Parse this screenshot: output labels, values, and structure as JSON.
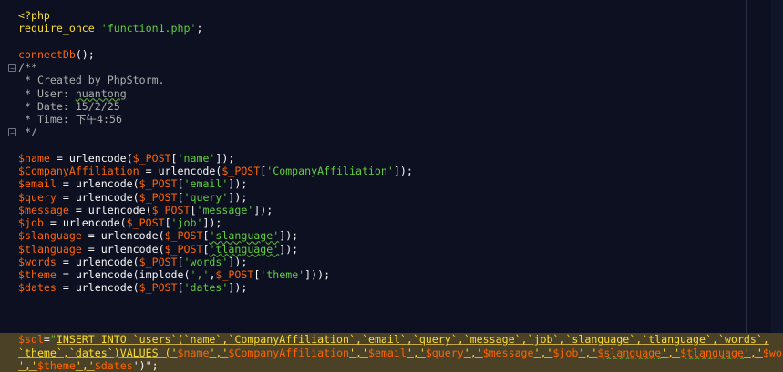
{
  "colors": {
    "background": "#0c1021",
    "keyword": "#fbde2d",
    "string": "#61ce3c",
    "variable": "#ff6400",
    "comment": "#aeaeae",
    "text": "#f8f8f8",
    "highlight_row": "#4b4126"
  },
  "icons": {
    "fold_open": "fold-open-icon",
    "fold_close": "fold-close-icon"
  },
  "lines": [
    {
      "tokens": [
        {
          "t": "<?php",
          "c": "k-kw"
        }
      ]
    },
    {
      "tokens": [
        {
          "t": "require_once ",
          "c": "k-kw"
        },
        {
          "t": "'function1.php'",
          "c": "k-str"
        },
        {
          "t": ";",
          "c": "k-plain"
        }
      ]
    },
    {
      "tokens": []
    },
    {
      "tokens": [
        {
          "t": "connectDb",
          "c": "k-var"
        },
        {
          "t": "();",
          "c": "k-plain"
        }
      ]
    },
    {
      "fold": "open",
      "tokens": [
        {
          "t": "/**",
          "c": "k-cmt"
        }
      ]
    },
    {
      "tokens": [
        {
          "t": " * Created by PhpStorm.",
          "c": "k-cmt"
        }
      ]
    },
    {
      "tokens": [
        {
          "t": " * User: ",
          "c": "k-cmt"
        },
        {
          "t": "huantong",
          "c": "k-cmt",
          "wavy": true
        }
      ]
    },
    {
      "tokens": [
        {
          "t": " * Date: 15/2/25",
          "c": "k-cmt"
        }
      ]
    },
    {
      "tokens": [
        {
          "t": " * Time: 下午4:56",
          "c": "k-cmt"
        }
      ]
    },
    {
      "fold": "close",
      "tokens": [
        {
          "t": " */",
          "c": "k-cmt"
        }
      ]
    },
    {
      "tokens": []
    },
    {
      "tokens": [
        {
          "t": "$name",
          "c": "k-var"
        },
        {
          "t": " = urlencode(",
          "c": "k-plain"
        },
        {
          "t": "$_POST",
          "c": "k-var"
        },
        {
          "t": "[",
          "c": "k-plain"
        },
        {
          "t": "'name'",
          "c": "k-str"
        },
        {
          "t": "]);",
          "c": "k-plain"
        }
      ]
    },
    {
      "tokens": [
        {
          "t": "$CompanyAffiliation",
          "c": "k-var"
        },
        {
          "t": " = urlencode(",
          "c": "k-plain"
        },
        {
          "t": "$_POST",
          "c": "k-var"
        },
        {
          "t": "[",
          "c": "k-plain"
        },
        {
          "t": "'CompanyAffiliation'",
          "c": "k-str"
        },
        {
          "t": "]);",
          "c": "k-plain"
        }
      ]
    },
    {
      "tokens": [
        {
          "t": "$email",
          "c": "k-var"
        },
        {
          "t": " = urlencode(",
          "c": "k-plain"
        },
        {
          "t": "$_POST",
          "c": "k-var"
        },
        {
          "t": "[",
          "c": "k-plain"
        },
        {
          "t": "'email'",
          "c": "k-str"
        },
        {
          "t": "]);",
          "c": "k-plain"
        }
      ]
    },
    {
      "tokens": [
        {
          "t": "$query",
          "c": "k-var"
        },
        {
          "t": " = urlencode(",
          "c": "k-plain"
        },
        {
          "t": "$_POST",
          "c": "k-var"
        },
        {
          "t": "[",
          "c": "k-plain"
        },
        {
          "t": "'query'",
          "c": "k-str"
        },
        {
          "t": "]);",
          "c": "k-plain"
        }
      ]
    },
    {
      "tokens": [
        {
          "t": "$message",
          "c": "k-var"
        },
        {
          "t": " = urlencode(",
          "c": "k-plain"
        },
        {
          "t": "$_POST",
          "c": "k-var"
        },
        {
          "t": "[",
          "c": "k-plain"
        },
        {
          "t": "'message'",
          "c": "k-str"
        },
        {
          "t": "]);",
          "c": "k-plain"
        }
      ]
    },
    {
      "tokens": [
        {
          "t": "$job",
          "c": "k-var"
        },
        {
          "t": " = urlencode(",
          "c": "k-plain"
        },
        {
          "t": "$_POST",
          "c": "k-var"
        },
        {
          "t": "[",
          "c": "k-plain"
        },
        {
          "t": "'job'",
          "c": "k-str"
        },
        {
          "t": "]);",
          "c": "k-plain"
        }
      ]
    },
    {
      "tokens": [
        {
          "t": "$slanguage",
          "c": "k-var"
        },
        {
          "t": " = urlencode(",
          "c": "k-plain"
        },
        {
          "t": "$_POST",
          "c": "k-var"
        },
        {
          "t": "[",
          "c": "k-plain"
        },
        {
          "t": "'slanguage'",
          "c": "k-str",
          "wavy": true
        },
        {
          "t": "]);",
          "c": "k-plain"
        }
      ]
    },
    {
      "tokens": [
        {
          "t": "$tlanguage",
          "c": "k-var"
        },
        {
          "t": " = urlencode(",
          "c": "k-plain"
        },
        {
          "t": "$_POST",
          "c": "k-var"
        },
        {
          "t": "[",
          "c": "k-plain"
        },
        {
          "t": "'tlanguage'",
          "c": "k-str",
          "wavy": true
        },
        {
          "t": "]);",
          "c": "k-plain"
        }
      ]
    },
    {
      "tokens": [
        {
          "t": "$words",
          "c": "k-var"
        },
        {
          "t": " = urlencode(",
          "c": "k-plain"
        },
        {
          "t": "$_POST",
          "c": "k-var"
        },
        {
          "t": "[",
          "c": "k-plain"
        },
        {
          "t": "'words'",
          "c": "k-str"
        },
        {
          "t": "]);",
          "c": "k-plain"
        }
      ]
    },
    {
      "tokens": [
        {
          "t": "$theme",
          "c": "k-var"
        },
        {
          "t": " = urlencode(implode(",
          "c": "k-plain"
        },
        {
          "t": "','",
          "c": "k-str"
        },
        {
          "t": ",",
          "c": "k-plain"
        },
        {
          "t": "$_POST",
          "c": "k-var"
        },
        {
          "t": "[",
          "c": "k-plain"
        },
        {
          "t": "'theme'",
          "c": "k-str"
        },
        {
          "t": "]));",
          "c": "k-plain"
        }
      ]
    },
    {
      "tokens": [
        {
          "t": "$dates",
          "c": "k-var"
        },
        {
          "t": " = urlencode(",
          "c": "k-plain"
        },
        {
          "t": "$_POST",
          "c": "k-var"
        },
        {
          "t": "[",
          "c": "k-plain"
        },
        {
          "t": "'dates'",
          "c": "k-str"
        },
        {
          "t": "]);",
          "c": "k-plain"
        }
      ]
    },
    {
      "tokens": []
    },
    {
      "tokens": []
    },
    {
      "tokens": []
    },
    {
      "highlight": true,
      "tokens": [
        {
          "t": "$sql",
          "c": "k-var"
        },
        {
          "t": "=",
          "c": "k-plain"
        },
        {
          "t": "\"",
          "c": "k-str"
        },
        {
          "t": "INSERT INTO ",
          "c": "k-sql"
        },
        {
          "t": "`users`",
          "c": "k-sql"
        },
        {
          "t": "(",
          "c": "k-sql"
        },
        {
          "t": "`name`",
          "c": "k-sql"
        },
        {
          "t": ",",
          "c": "k-sql"
        },
        {
          "t": "`CompanyAffiliation`",
          "c": "k-sql"
        },
        {
          "t": ",",
          "c": "k-sql"
        },
        {
          "t": "`email`",
          "c": "k-sql"
        },
        {
          "t": ",",
          "c": "k-sql"
        },
        {
          "t": "`query`",
          "c": "k-sql"
        },
        {
          "t": ",",
          "c": "k-sql"
        },
        {
          "t": "`message`",
          "c": "k-sql"
        },
        {
          "t": ",",
          "c": "k-sql"
        },
        {
          "t": "`job`",
          "c": "k-sql"
        },
        {
          "t": ",",
          "c": "k-sql"
        },
        {
          "t": "`slanguage`",
          "c": "k-sql"
        },
        {
          "t": ",",
          "c": "k-sql"
        },
        {
          "t": "`tlanguage`",
          "c": "k-sql"
        },
        {
          "t": ",",
          "c": "k-sql"
        },
        {
          "t": "`words`",
          "c": "k-sql"
        },
        {
          "t": ",",
          "c": "k-sql"
        }
      ]
    },
    {
      "highlight": true,
      "tokens": [
        {
          "t": "`theme`",
          "c": "k-sql"
        },
        {
          "t": ",",
          "c": "k-sql"
        },
        {
          "t": "`dates`",
          "c": "k-sql"
        },
        {
          "t": ")",
          "c": "k-sql"
        },
        {
          "t": "VALUES (",
          "c": "k-sql"
        },
        {
          "t": "'",
          "c": "k-sql"
        },
        {
          "t": "$name",
          "c": "k-var"
        },
        {
          "t": "','",
          "c": "k-sql"
        },
        {
          "t": "$CompanyAffiliation",
          "c": "k-var"
        },
        {
          "t": "','",
          "c": "k-sql"
        },
        {
          "t": "$email",
          "c": "k-var"
        },
        {
          "t": "','",
          "c": "k-sql"
        },
        {
          "t": "$query",
          "c": "k-var"
        },
        {
          "t": "','",
          "c": "k-sql"
        },
        {
          "t": "$message",
          "c": "k-var"
        },
        {
          "t": "','",
          "c": "k-sql"
        },
        {
          "t": "$job",
          "c": "k-var"
        },
        {
          "t": "','",
          "c": "k-sql"
        },
        {
          "t": "$slanguage",
          "c": "k-var",
          "wavy": true
        },
        {
          "t": "','",
          "c": "k-sql"
        },
        {
          "t": "$tlanguage",
          "c": "k-var",
          "wavy": true
        },
        {
          "t": "','",
          "c": "k-sql"
        },
        {
          "t": "$words",
          "c": "k-var"
        }
      ]
    },
    {
      "highlight": true,
      "tokens": [
        {
          "t": "','",
          "c": "k-sql"
        },
        {
          "t": "$theme",
          "c": "k-var"
        },
        {
          "t": "','",
          "c": "k-sql"
        },
        {
          "t": "$dates",
          "c": "k-var"
        },
        {
          "t": "')\";",
          "c": "k-plain"
        }
      ]
    }
  ]
}
